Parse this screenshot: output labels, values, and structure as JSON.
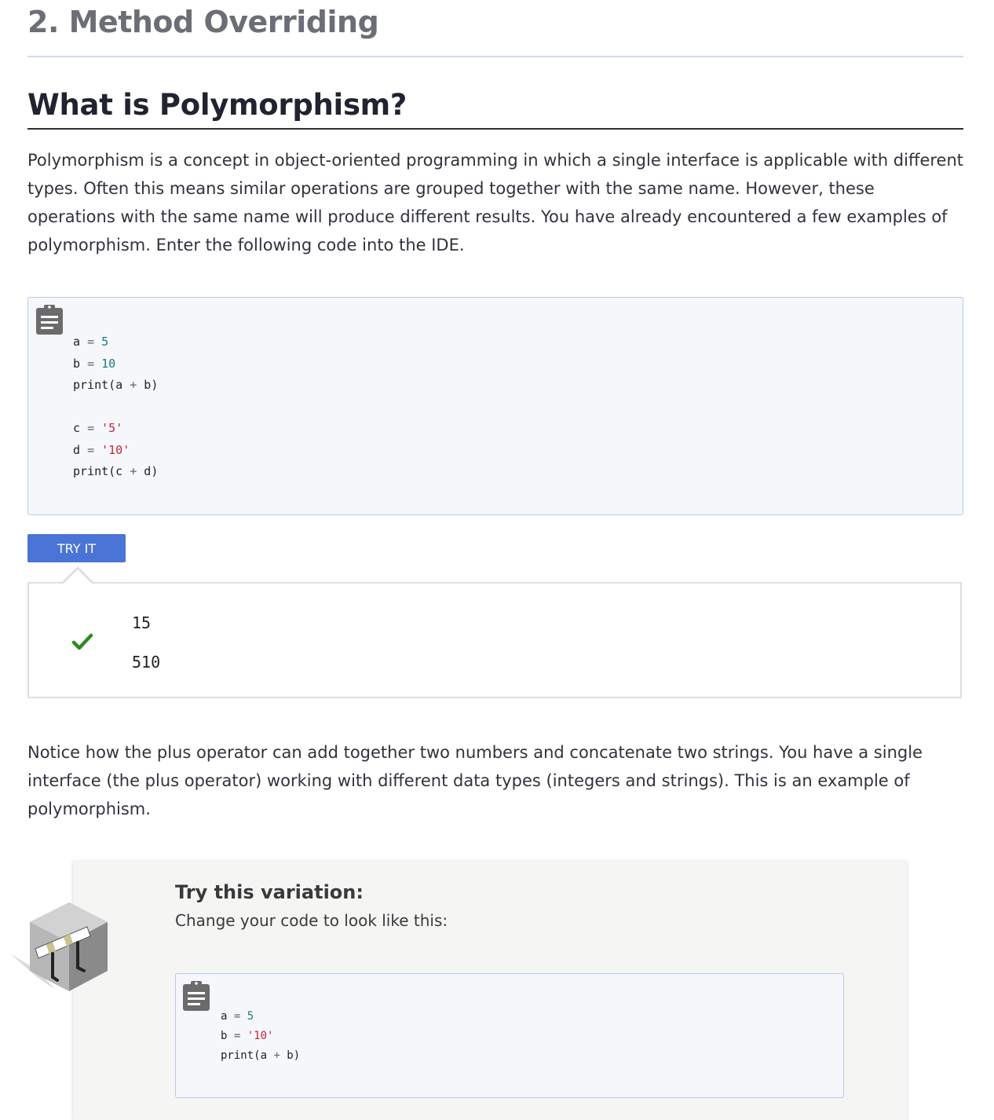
{
  "section_heading": "2. Method Overriding",
  "title": "What is Polymorphism?",
  "intro_paragraph": "Polymorphism is a concept in object-oriented programming in which a single interface is applicable with different types. Often this means similar operations are grouped together with the same name. However, these operations with the same name will produce different results. You have already encountered a few examples of polymorphism. Enter the following code into the IDE.",
  "code_block": {
    "copy_icon": "clipboard-icon",
    "lines": [
      [
        {
          "t": "a "
        },
        {
          "t": "=",
          "k": "op"
        },
        {
          "t": " "
        },
        {
          "t": "5",
          "k": "num"
        }
      ],
      [
        {
          "t": "b "
        },
        {
          "t": "=",
          "k": "op"
        },
        {
          "t": " "
        },
        {
          "t": "10",
          "k": "num"
        }
      ],
      [
        {
          "t": "print(a "
        },
        {
          "t": "+",
          "k": "op"
        },
        {
          "t": " b)"
        }
      ],
      [],
      [
        {
          "t": "c "
        },
        {
          "t": "=",
          "k": "op"
        },
        {
          "t": " "
        },
        {
          "t": "'5'",
          "k": "str"
        }
      ],
      [
        {
          "t": "d "
        },
        {
          "t": "=",
          "k": "op"
        },
        {
          "t": " "
        },
        {
          "t": "'10'",
          "k": "str"
        }
      ],
      [
        {
          "t": "print(c "
        },
        {
          "t": "+",
          "k": "op"
        },
        {
          "t": " d)"
        }
      ]
    ]
  },
  "try_button": {
    "label": "TRY IT"
  },
  "output": {
    "status_icon": "checkmark-icon",
    "status_color": "#2e8b1f",
    "lines": [
      "15",
      "510"
    ]
  },
  "notice_paragraph": "Notice how the plus operator can add together two numbers and concatenate two strings. You have a single interface (the plus operator) working with different data types (integers and strings). This is an example of polymorphism.",
  "variation": {
    "icon": "roadblock-icon",
    "title": "Try this variation:",
    "subtitle": "Change your code to look like this:",
    "code_block": {
      "copy_icon": "clipboard-icon",
      "lines": [
        [
          {
            "t": "a "
          },
          {
            "t": "=",
            "k": "op"
          },
          {
            "t": " "
          },
          {
            "t": "5",
            "k": "num"
          }
        ],
        [
          {
            "t": "b "
          },
          {
            "t": "=",
            "k": "op"
          },
          {
            "t": " "
          },
          {
            "t": "'10'",
            "k": "str"
          }
        ],
        [
          {
            "t": "print(a "
          },
          {
            "t": "+",
            "k": "op"
          },
          {
            "t": " b)"
          }
        ]
      ]
    }
  },
  "colors": {
    "accent": "#4a74d6",
    "code_number": "#1b7a7a",
    "code_string": "#c4253b"
  }
}
